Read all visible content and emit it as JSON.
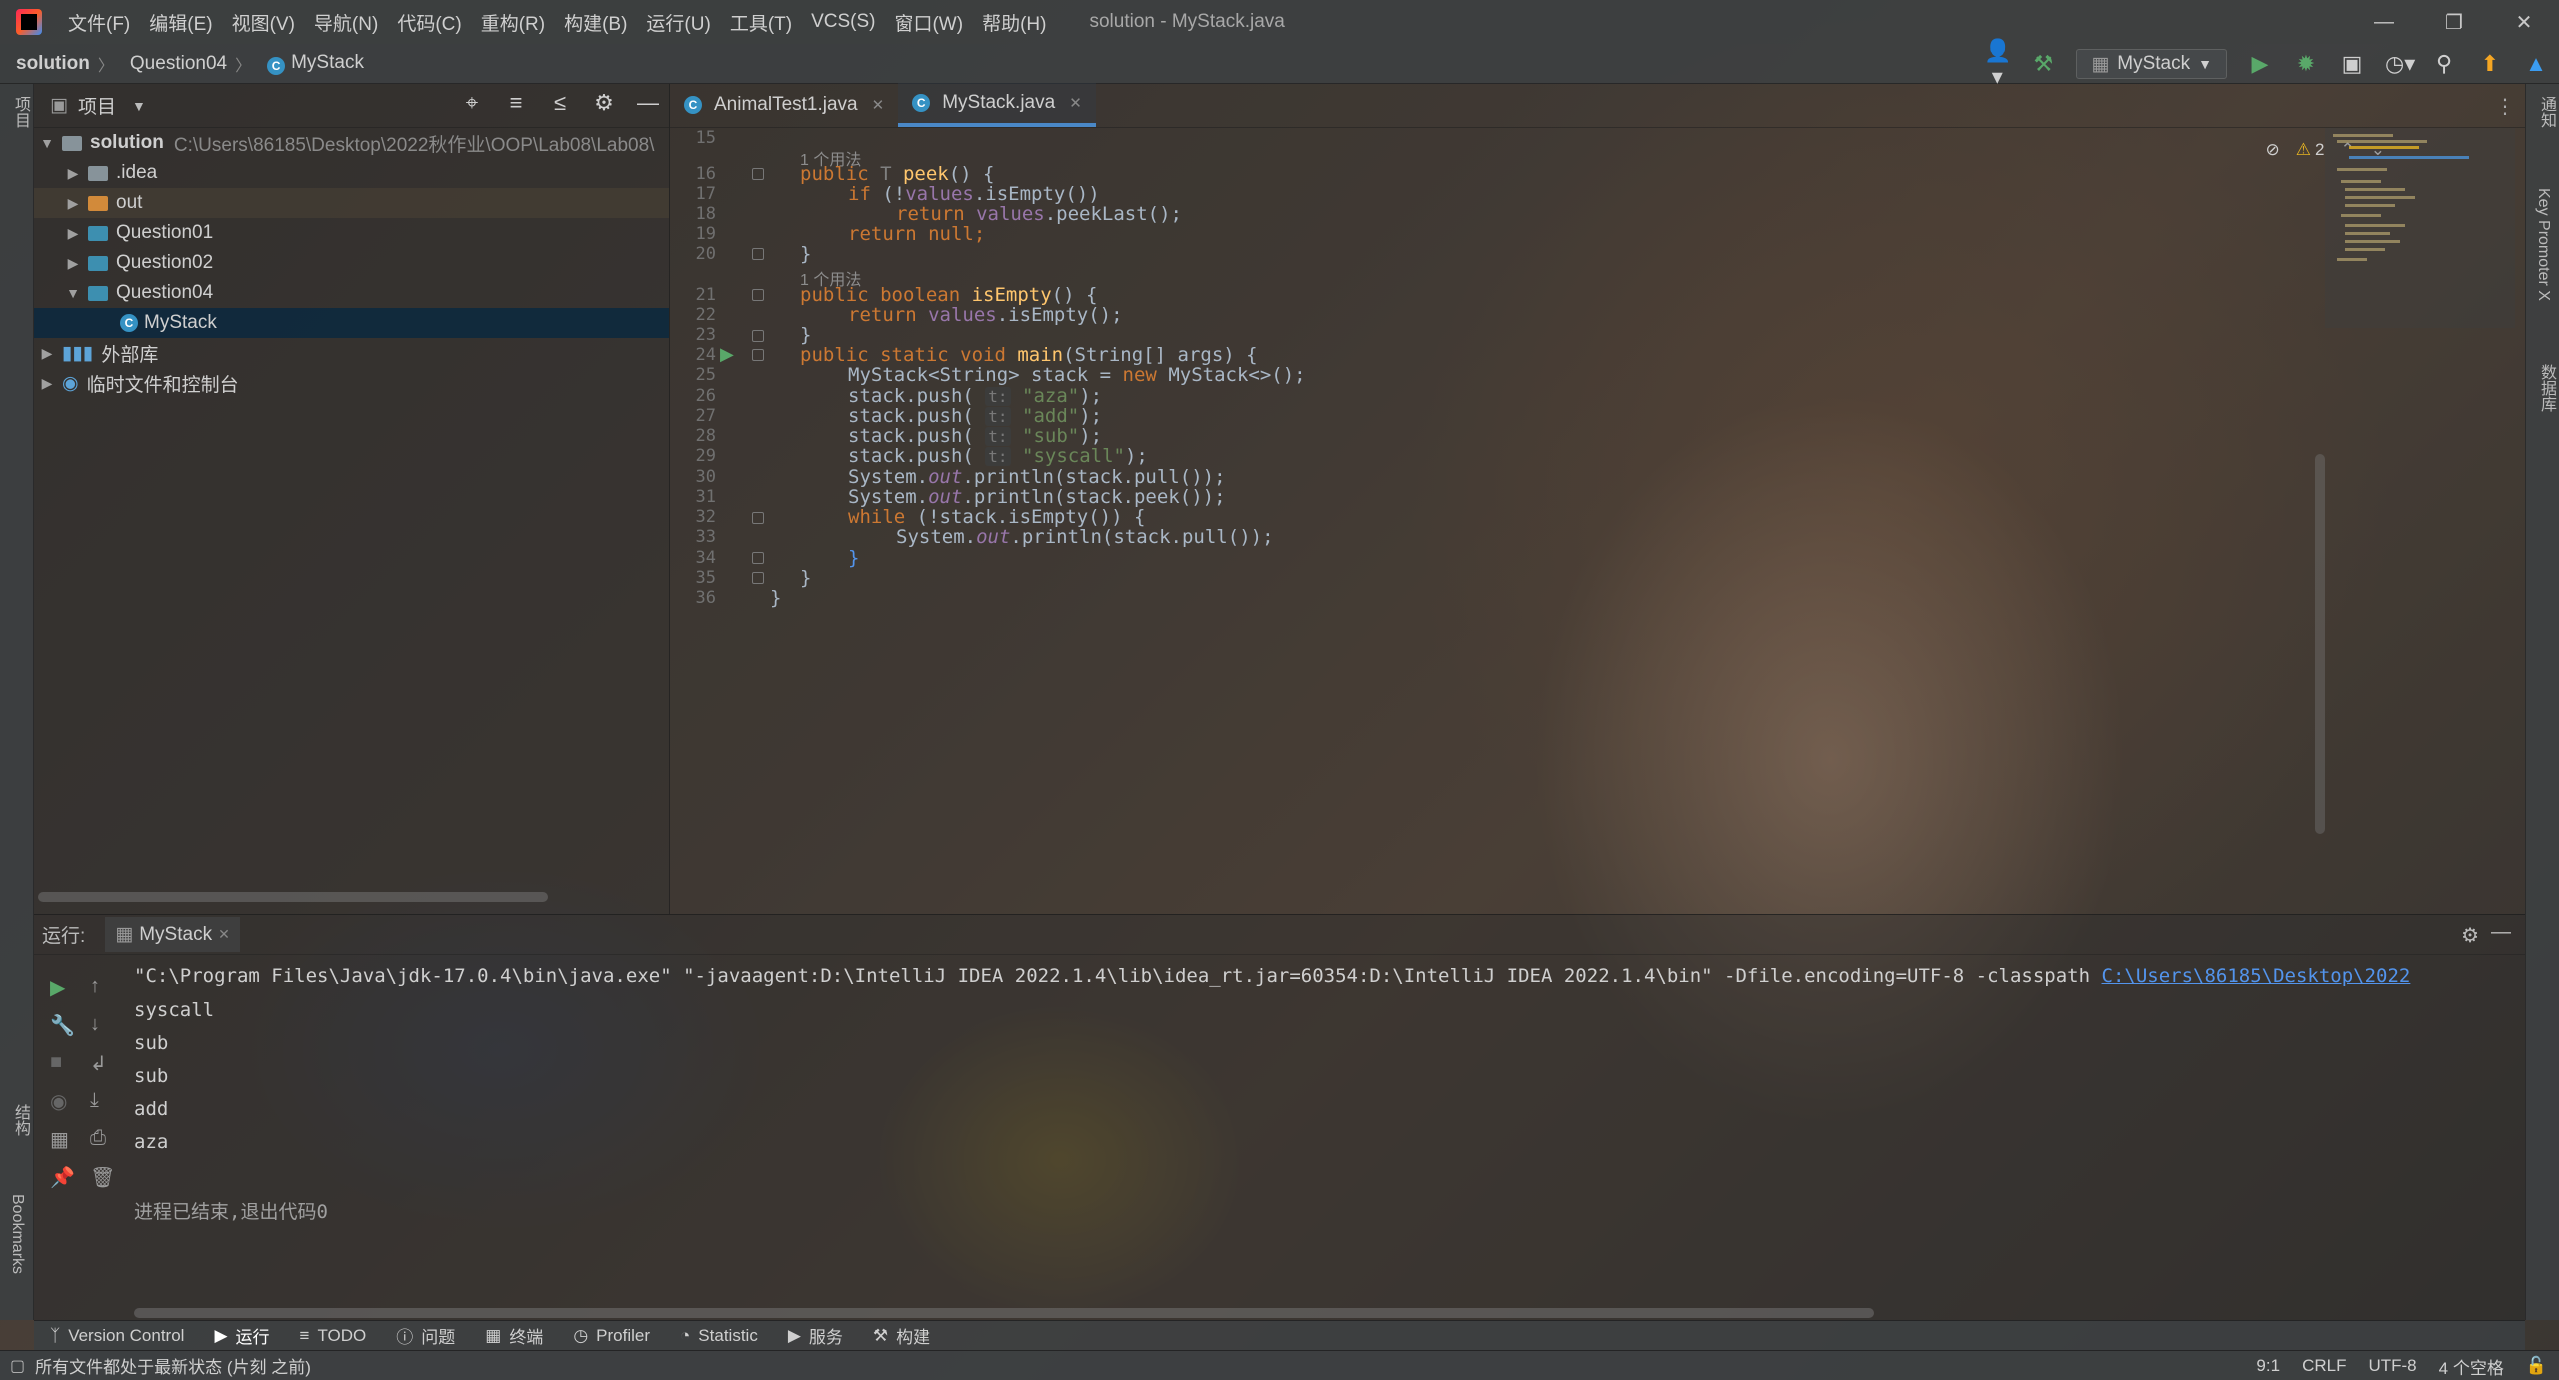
{
  "window": {
    "title": "solution - MyStack.java",
    "menu": [
      "文件(F)",
      "编辑(E)",
      "视图(V)",
      "导航(N)",
      "代码(C)",
      "重构(R)",
      "构建(B)",
      "运行(U)",
      "工具(T)",
      "VCS(S)",
      "窗口(W)",
      "帮助(H)"
    ]
  },
  "navbar": {
    "project": "solution",
    "folder": "Question04",
    "file": "MyStack",
    "run_config": "MyStack"
  },
  "left_strip": {
    "project": "项目",
    "structure": "结构",
    "bookmarks": "Bookmarks"
  },
  "right_strip": {
    "notifications": "通知",
    "key_promoter": "Key Promoter X",
    "database": "数据库"
  },
  "project_panel": {
    "title": "项目",
    "root_name": "solution",
    "root_path": "C:\\Users\\86185\\Desktop\\2022秋作业\\OOP\\Lab08\\Lab08\\",
    "items": [
      ".idea",
      "out",
      "Question01",
      "Question02",
      "Question04",
      "MyStack",
      "外部库",
      "临时文件和控制台"
    ]
  },
  "editor": {
    "tabs": [
      "AnimalTest1.java",
      "MyStack.java"
    ],
    "warning_count": "2",
    "usage_hint": "1 个用法",
    "line_numbers": [
      "15",
      "16",
      "17",
      "18",
      "19",
      "20",
      "21",
      "22",
      "23",
      "24",
      "25",
      "26",
      "27",
      "28",
      "29",
      "30",
      "31",
      "32",
      "33",
      "34",
      "35",
      "36"
    ],
    "code": {
      "l16_a": "public ",
      "l16_b": "T ",
      "l16_c": "peek",
      "l16_d": "() {",
      "l17_a": "if ",
      "l17_b": "(!",
      "l17_c": "values",
      "l17_d": ".isEmpty())",
      "l18_a": "return ",
      "l18_b": "values",
      "l18_c": ".peekLast();",
      "l19_a": "return null",
      "l19_b": ";",
      "l20": "}",
      "l21_a": "public boolean ",
      "l21_b": "isEmpty",
      "l21_c": "() {",
      "l22_a": "return ",
      "l22_b": "values",
      "l22_c": ".isEmpty();",
      "l23": "}",
      "l24_a": "public static void ",
      "l24_b": "main",
      "l24_c": "(String[] args) {",
      "l25_a": "MyStack<String> stack = ",
      "l25_b": "new ",
      "l25_c": "MyStack<>();",
      "push": "stack.push(",
      "t_hint": "t:",
      "s_aza": "\"aza\"",
      "s_add": "\"add\"",
      "s_sub": "\"sub\"",
      "s_syscall": "\"syscall\"",
      "close_stmt": ");",
      "sys": "System.",
      "out": "out",
      "println": ".println(",
      "pull": "stack.pull()",
      "peek": "stack.peek()",
      "end_call": ");",
      "l32_a": "while ",
      "l32_b": "(!stack.isEmpty()) {",
      "l34": "}",
      "l35": "}",
      "l36": "}"
    }
  },
  "run_panel": {
    "label": "运行:",
    "tab": "MyStack",
    "command": "\"C:\\Program Files\\Java\\jdk-17.0.4\\bin\\java.exe\" \"-javaagent:D:\\IntelliJ IDEA 2022.1.4\\lib\\idea_rt.jar=60354:D:\\IntelliJ IDEA 2022.1.4\\bin\" -Dfile.encoding=UTF-8 -classpath ",
    "command_link": "C:\\Users\\86185\\Desktop\\2022",
    "output": [
      "syscall",
      "sub",
      "sub",
      "add",
      "aza"
    ],
    "exit": "进程已结束,退出代码0"
  },
  "tool_tabs": [
    "Version Control",
    "运行",
    "TODO",
    "问题",
    "终端",
    "Profiler",
    "Statistic",
    "服务",
    "构建"
  ],
  "statusbar": {
    "message": "所有文件都处于最新状态 (片刻 之前)",
    "position": "9:1",
    "line_sep": "CRLF",
    "encoding": "UTF-8",
    "indent": "4 个空格"
  },
  "colors": {
    "keyword": "#cc7832",
    "function": "#ffc66d",
    "string": "#6a8759",
    "field": "#9876aa",
    "link": "#5394ec",
    "accent": "#4a88c7"
  }
}
